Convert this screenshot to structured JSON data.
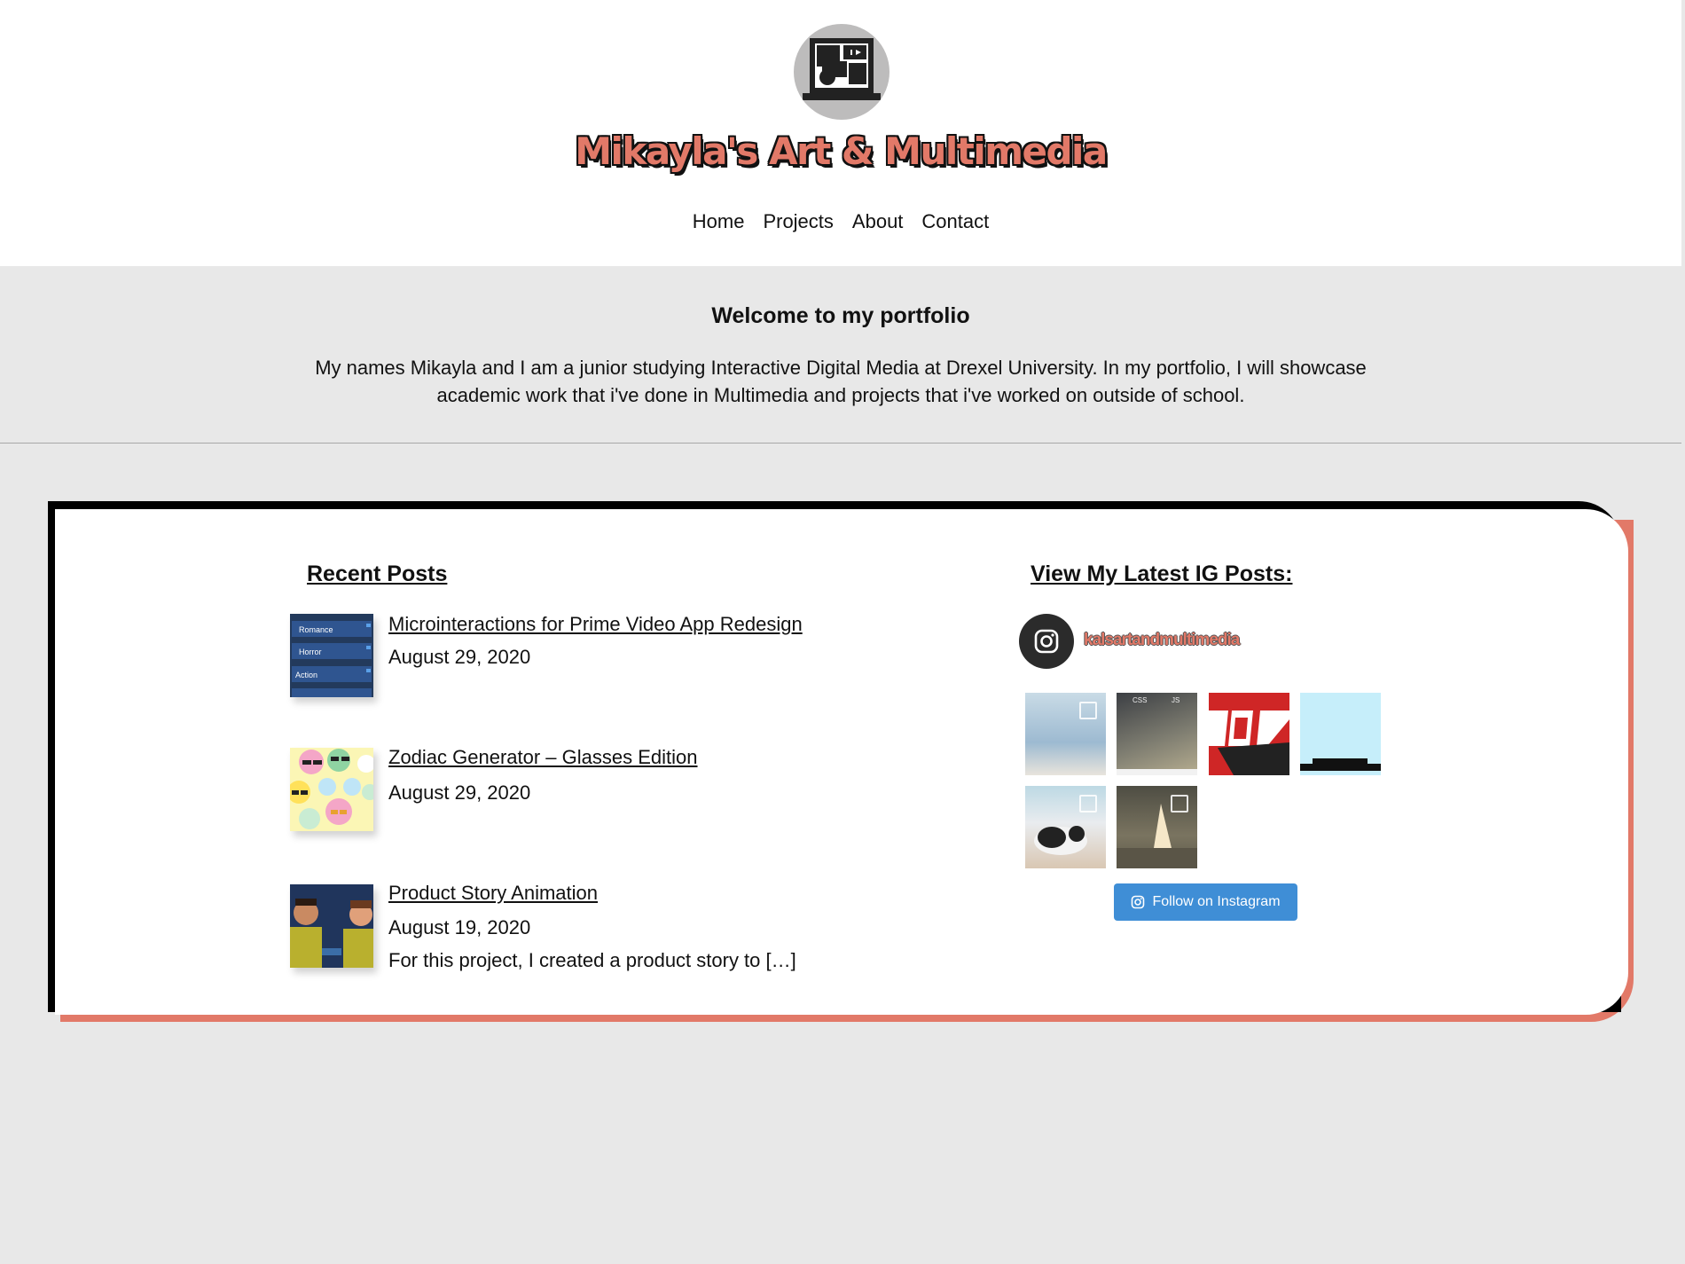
{
  "site": {
    "title": "Mikayla's Art & Multimedia",
    "nav": [
      "Home",
      "Projects",
      "About",
      "Contact"
    ]
  },
  "intro": {
    "heading": "Welcome to my portfolio",
    "body": "My names Mikayla and I am a junior studying Interactive Digital Media at Drexel University. In my portfolio, I will showcase academic work that i've done in Multimedia and projects that i've worked on outside of school."
  },
  "recent_posts": {
    "heading": "Recent Posts",
    "items": [
      {
        "title": "Microinteractions for Prime Video App Redesign",
        "date": "August 29, 2020",
        "excerpt": "",
        "thumb_labels": [
          "Romance",
          "Horror",
          "Action"
        ]
      },
      {
        "title": "Zodiac Generator – Glasses Edition",
        "date": "August 29, 2020",
        "excerpt": ""
      },
      {
        "title": "Product Story Animation",
        "date": "August 19, 2020",
        "excerpt": "For this project, I created a product story to […]"
      }
    ]
  },
  "instagram": {
    "heading": "View My Latest IG Posts:",
    "handle": "kalsartandmultimedia",
    "follow_label": "Follow on Instagram",
    "tile2_labels": [
      "CSS",
      "JS"
    ]
  },
  "colors": {
    "accent": "#e27968",
    "button": "#3f8ed6",
    "background": "#e8e8e8"
  }
}
